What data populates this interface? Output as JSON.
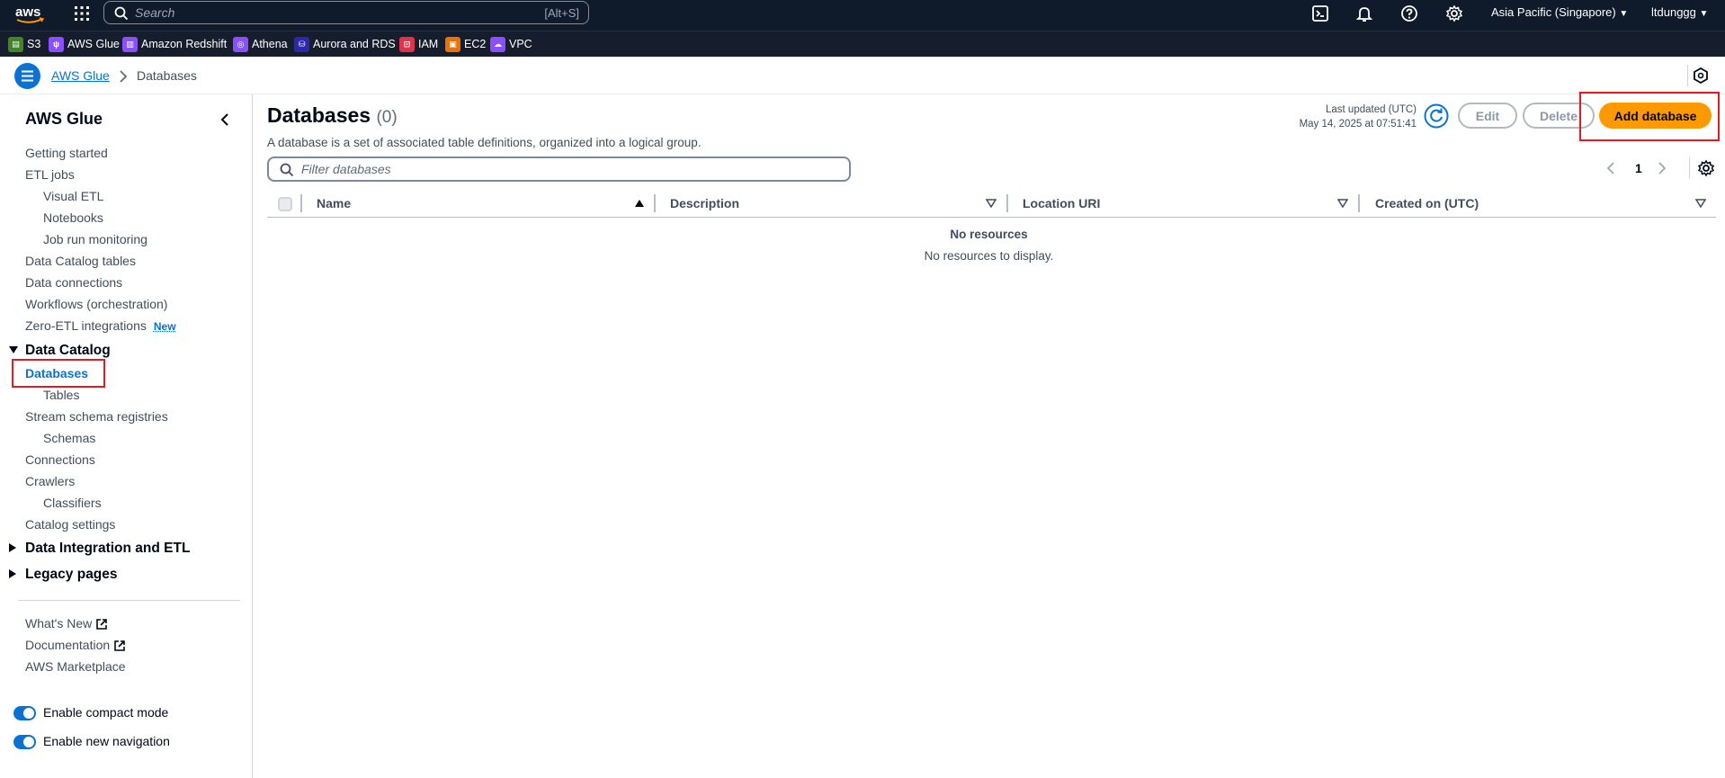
{
  "topnav": {
    "logo": "aws",
    "search_placeholder": "Search",
    "search_shortcut": "[Alt+S]",
    "region": "Asia Pacific (Singapore)",
    "user": "ltdunggg"
  },
  "favorites": [
    {
      "label": "S3",
      "color": "#3f8624"
    },
    {
      "label": "AWS Glue",
      "color": "#8c4fff"
    },
    {
      "label": "Amazon Redshift",
      "color": "#8c4fff"
    },
    {
      "label": "Athena",
      "color": "#8c4fff"
    },
    {
      "label": "Aurora and RDS",
      "color": "#2e27ad"
    },
    {
      "label": "IAM",
      "color": "#dd344c"
    },
    {
      "label": "EC2",
      "color": "#ed7100"
    },
    {
      "label": "VPC",
      "color": "#8c4fff"
    }
  ],
  "breadcrumb": {
    "link": "AWS Glue",
    "current": "Databases"
  },
  "sidebar": {
    "title": "AWS Glue",
    "items": {
      "getting_started": "Getting started",
      "etl_jobs": "ETL jobs",
      "visual_etl": "Visual ETL",
      "notebooks": "Notebooks",
      "job_run_monitoring": "Job run monitoring",
      "data_catalog_tables": "Data Catalog tables",
      "data_connections": "Data connections",
      "workflows": "Workflows (orchestration)",
      "zero_etl": "Zero-ETL integrations",
      "zero_etl_badge": "New",
      "data_catalog": "Data Catalog",
      "databases": "Databases",
      "tables": "Tables",
      "stream_schema_registries": "Stream schema registries",
      "schemas": "Schemas",
      "connections": "Connections",
      "crawlers": "Crawlers",
      "classifiers": "Classifiers",
      "catalog_settings": "Catalog settings",
      "data_integration": "Data Integration and ETL",
      "legacy_pages": "Legacy pages",
      "whats_new": "What's New",
      "documentation": "Documentation",
      "marketplace": "AWS Marketplace",
      "compact_mode": "Enable compact mode",
      "new_navigation": "Enable new navigation"
    }
  },
  "main": {
    "title": "Databases",
    "count": "(0)",
    "description": "A database is a set of associated table definitions, organized into a logical group.",
    "last_updated_label": "Last updated (UTC)",
    "last_updated_value": "May 14, 2025 at 07:51:41",
    "edit": "Edit",
    "delete": "Delete",
    "add": "Add database",
    "filter_placeholder": "Filter databases",
    "page": "1",
    "columns": [
      "Name",
      "Description",
      "Location URI",
      "Created on (UTC)"
    ],
    "empty_title": "No resources",
    "empty_sub": "No resources to display."
  }
}
